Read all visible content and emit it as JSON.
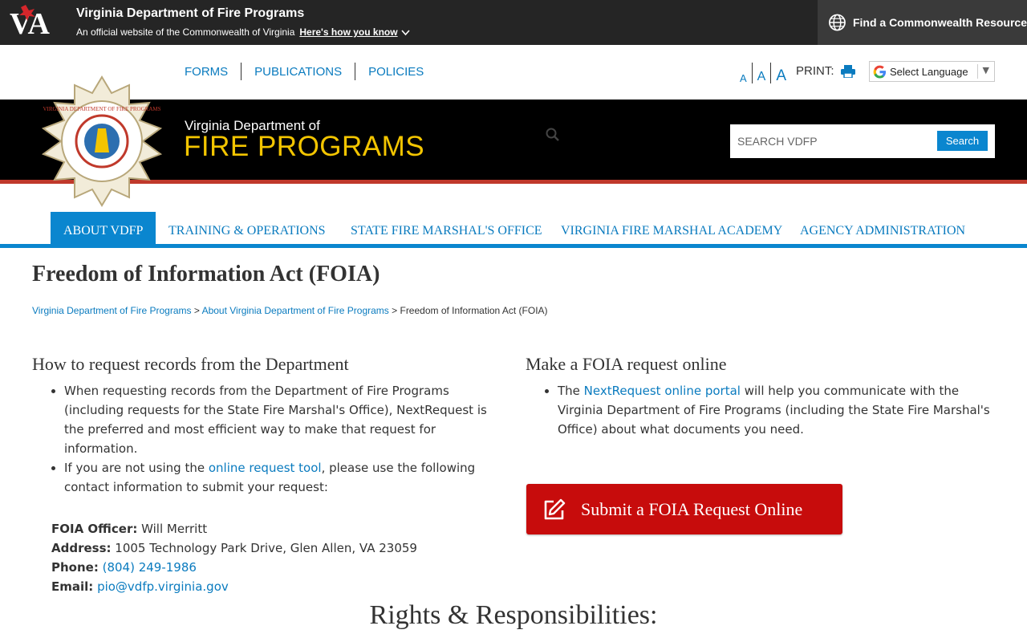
{
  "va_bar": {
    "logo_text": "VA",
    "title": "Virginia Department of Fire Programs",
    "subtitle": "An official website of the Commonwealth of Virginia",
    "how_link": "Here's how you know",
    "find_resource": "Find a Commonwealth Resource"
  },
  "utility": {
    "links": [
      "FORMS",
      "PUBLICATIONS",
      "POLICIES"
    ],
    "font_sizes": [
      "A",
      "A",
      "A"
    ],
    "print_label": "PRINT:",
    "language_label": "Select Language"
  },
  "header": {
    "seal_text": "VIRGINIA DEPARTMENT OF FIRE PROGRAMS",
    "brand_top": "Virginia Department of",
    "brand_main": "FIRE PROGRAMS",
    "search_placeholder": "SEARCH VDFP",
    "search_button": "Search"
  },
  "nav": {
    "items": [
      {
        "label": "ABOUT VDFP",
        "active": true
      },
      {
        "label": "TRAINING & OPERATIONS",
        "active": false
      },
      {
        "label": "STATE FIRE MARSHAL'S OFFICE",
        "active": false
      },
      {
        "label": "VIRGINIA FIRE MARSHAL ACADEMY",
        "active": false
      },
      {
        "label": "AGENCY ADMINISTRATION",
        "active": false
      }
    ]
  },
  "page": {
    "title": "Freedom of Information Act (FOIA)",
    "breadcrumb": [
      "Virginia Department of Fire Programs",
      "About Virginia Department of Fire Programs",
      "Freedom of Information Act (FOIA)"
    ],
    "breadcrumb_sep": ">"
  },
  "left": {
    "heading": "How to request records from the Department",
    "bullet1": "When requesting records from the Department of Fire Programs (including requests for the State Fire Marshal's Office), NextRequest is the preferred and most efficient way to make that request for information.",
    "bullet2_pre": "If you are not using the ",
    "bullet2_link": "online request tool",
    "bullet2_post": ", please use the following contact information to submit your request:",
    "contact": {
      "officer_label": "FOIA Officer:",
      "officer": "Will Merritt",
      "address_label": "Address:",
      "address": "1005 Technology Park Drive, Glen Allen, VA 23059",
      "phone_label": "Phone:",
      "phone": "(804) 249-1986",
      "email_label": "Email:",
      "email": "pio@vdfp.virginia.gov"
    }
  },
  "right": {
    "heading": "Make a FOIA request online",
    "bullet_pre": "The ",
    "bullet_link": "NextRequest online portal",
    "bullet_post": " will help you communicate with the Virginia Department of Fire Programs (including the State Fire Marshal's Office) about what documents you need.",
    "button": "Submit a FOIA Request Online"
  },
  "rights_heading": "Rights & Responsibilities:",
  "colors": {
    "topbar": "#252525",
    "link": "#0a7bbf",
    "accent_blue": "#0a86cf",
    "brand_gold": "#f3c500",
    "button_red": "#c70c0c",
    "header_red_line": "#c0392b"
  }
}
